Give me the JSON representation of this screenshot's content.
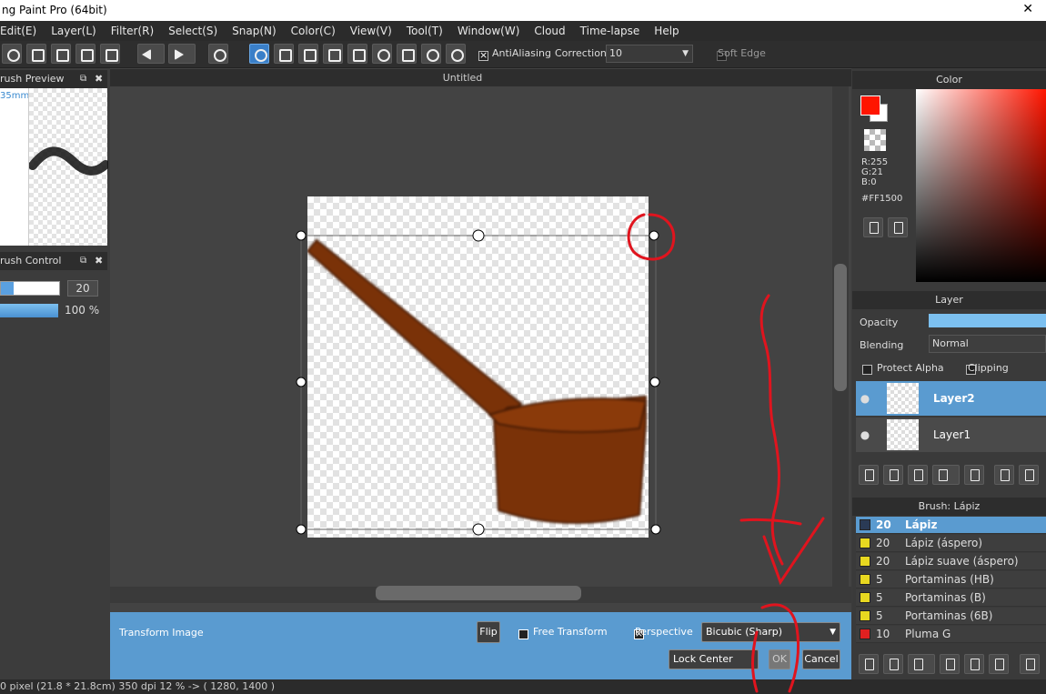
{
  "window": {
    "title": "ng Paint Pro (64bit)",
    "close_glyph": "✕"
  },
  "menu": [
    "Edit(E)",
    "Layer(L)",
    "Filter(R)",
    "Select(S)",
    "Snap(N)",
    "Color(C)",
    "View(V)",
    "Tool(T)",
    "Window(W)",
    "Cloud",
    "Time-lapse",
    "Help"
  ],
  "toolbar": {
    "antialiasing_label": "AntiAliasing",
    "correction_label": "Correction",
    "correction_value": "10",
    "soft_edge_label": "Soft Edge"
  },
  "brush_preview": {
    "title": "rush Preview",
    "size_label": "35mm"
  },
  "brush_control": {
    "title": "rush Control",
    "size_value": "20",
    "opacity_value": "100 %"
  },
  "document": {
    "tab_title": "Untitled"
  },
  "transform": {
    "title": "Transform Image",
    "flip_label": "Flip",
    "free_transform_label": "Free Transform",
    "perspective_label": "Perspective",
    "interpolation_value": "Bicubic (Sharp)",
    "lock_center_label": "Lock Center",
    "ok_label": "OK",
    "cancel_label": "Cancel"
  },
  "status": {
    "text": "0 pixel   (21.8 * 21.8cm)   350 dpi   12 %   -> ( 1280, 1400 )"
  },
  "color_panel": {
    "title": "Color",
    "r": "R:255",
    "g": "G:21",
    "b": "B:0",
    "hex": "#FF1500",
    "fg_color": "#ff1500"
  },
  "layer_panel": {
    "title": "Layer",
    "opacity_label": "Opacity",
    "blending_label": "Blending",
    "blending_value": "Normal",
    "protect_alpha_label": "Protect Alpha",
    "clipping_label": "Clipping",
    "layers": [
      {
        "name": "Layer2",
        "selected": true
      },
      {
        "name": "Layer1",
        "selected": false
      }
    ]
  },
  "brush_panel": {
    "title": "Brush: Lápiz",
    "brushes": [
      {
        "size": "20",
        "name": "Lápiz",
        "color": "#2a3a55",
        "selected": true
      },
      {
        "size": "20",
        "name": "Lápiz (áspero)",
        "color": "#e8d820",
        "selected": false
      },
      {
        "size": "20",
        "name": "Lápiz suave (áspero)",
        "color": "#e8d820",
        "selected": false
      },
      {
        "size": "5",
        "name": "Portaminas (HB)",
        "color": "#e8d820",
        "selected": false
      },
      {
        "size": "5",
        "name": "Portaminas (B)",
        "color": "#e8d820",
        "selected": false
      },
      {
        "size": "5",
        "name": "Portaminas (6B)",
        "color": "#e8d820",
        "selected": false
      },
      {
        "size": "10",
        "name": "Pluma G",
        "color": "#e02020",
        "selected": false
      }
    ]
  }
}
